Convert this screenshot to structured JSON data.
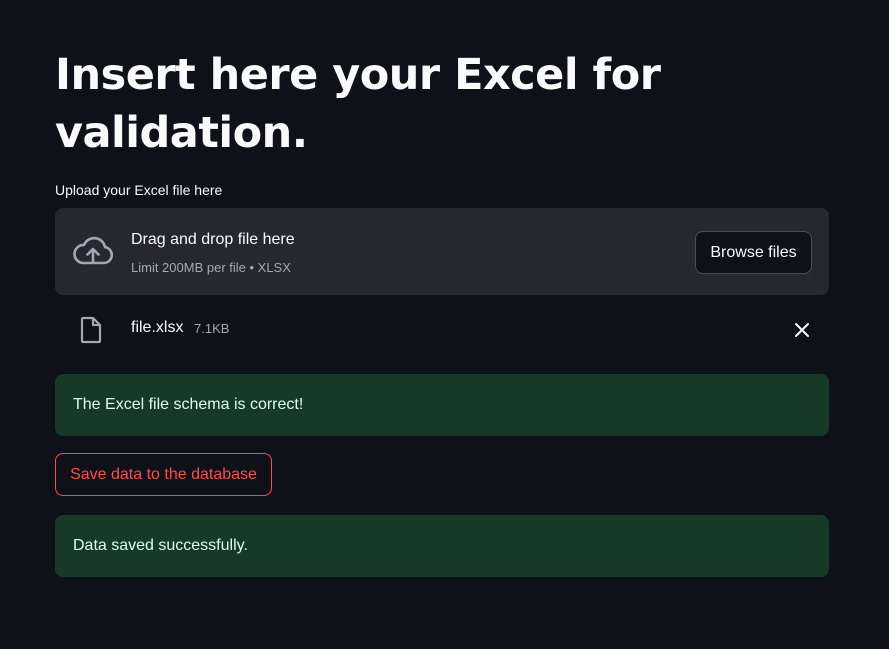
{
  "page": {
    "title": "Insert here your Excel for validation."
  },
  "uploader": {
    "label": "Upload your Excel file here",
    "drop_title": "Drag and drop file here",
    "drop_limit": "Limit 200MB per file • XLSX",
    "browse_label": "Browse files",
    "cloud_icon": "cloud-upload-icon"
  },
  "uploaded_file": {
    "name": "file.xlsx",
    "size": "7.1KB",
    "file_icon": "file-icon",
    "remove_icon": "close-icon"
  },
  "alerts": {
    "schema_ok": "The Excel file schema is correct!",
    "saved_ok": "Data saved successfully."
  },
  "actions": {
    "save_label": "Save data to the database"
  },
  "colors": {
    "background": "#0e1117",
    "dropzone": "#262730",
    "success_bg": "#173928",
    "success_text": "#dffde9",
    "accent_red": "#ff4b4b"
  }
}
